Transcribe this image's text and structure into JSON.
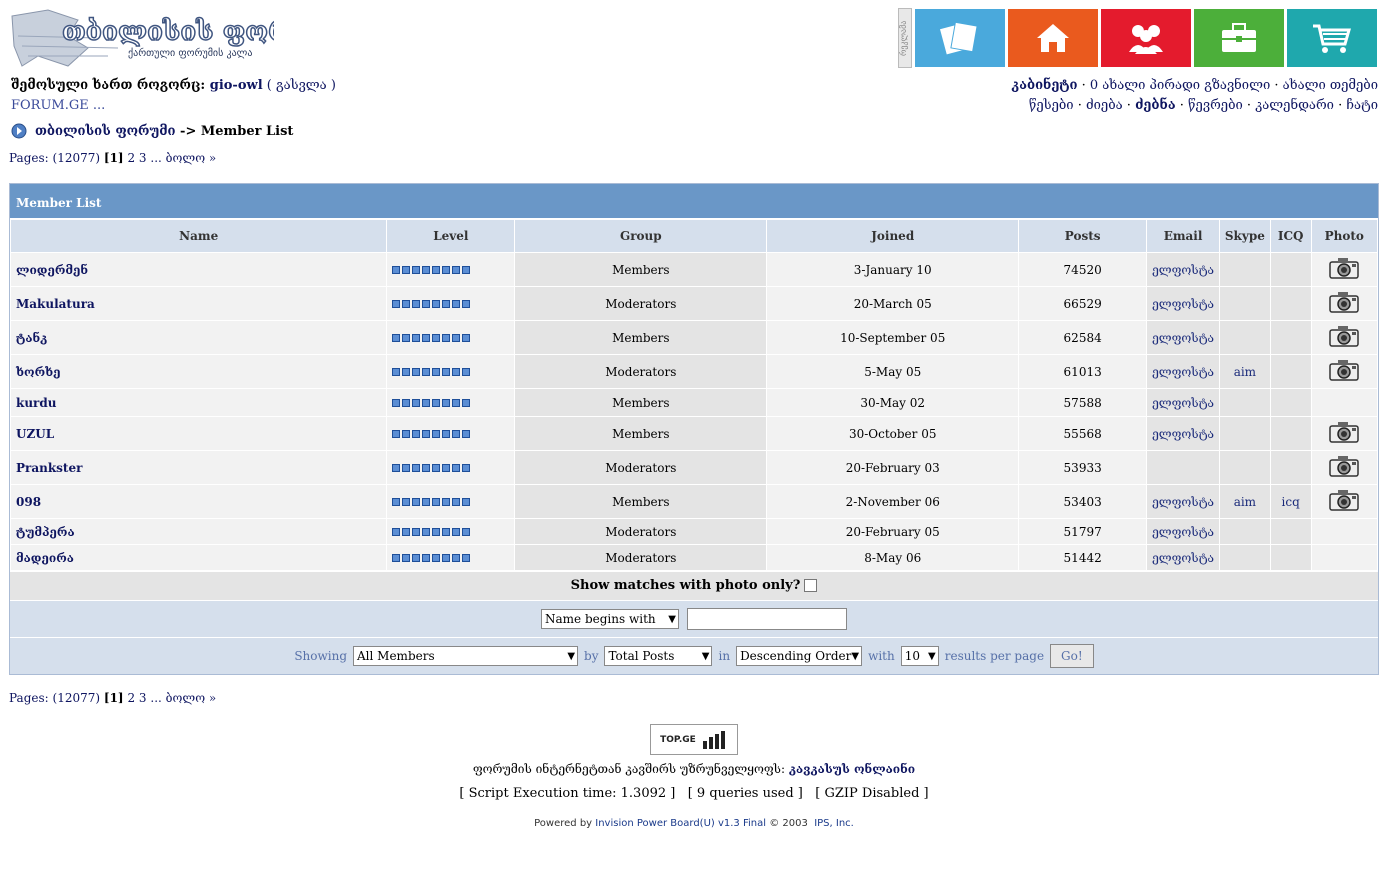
{
  "header": {
    "logo_text": "თბილისის ფორუმი",
    "logo_sub": "ქართული ფორუმის კალა",
    "side_label": "რეკლამა",
    "user_prefix": "შემოსული ხართ როგორც: ",
    "username": "gio-owl",
    "logout": "( გასვლა )",
    "forum_link": "FORUM.GE ...",
    "links1": [
      "კაბინეტი",
      "0 ახალი პირადი გზავნილი",
      "ახალი თემები"
    ],
    "links2": [
      "წესები",
      "ძიება",
      "ძებნა",
      "წევრები",
      "კალენდარი",
      "ჩატი"
    ],
    "tile_colors": [
      "#4aa9dc",
      "#ea5a1e",
      "#e41b2d",
      "#4caf3a",
      "#1fa8ad"
    ],
    "tile_icons": [
      "papers-icon",
      "home-icon",
      "people-icon",
      "briefcase-icon",
      "cart-icon"
    ]
  },
  "nav": {
    "forum": "თბილისის ფორუმი",
    "sep": "->",
    "page": "Member List"
  },
  "pages": {
    "label": "Pages:",
    "count": "(12077)",
    "current": "[1]",
    "p2": "2",
    "p3": "3",
    "dots": "...",
    "last": "ბოლო »"
  },
  "table": {
    "title": "Member List",
    "headers": [
      "Name",
      "Level",
      "Group",
      "Joined",
      "Posts",
      "Email",
      "Skype",
      "ICQ",
      "Photo"
    ],
    "rows": [
      {
        "name": "ლიდერმენ",
        "group": "Members",
        "joined": "3-January 10",
        "posts": "74520",
        "email": "ელფოსტა",
        "skype": "",
        "icq": "",
        "photo": true
      },
      {
        "name": "Makulatura",
        "group": "Moderators",
        "joined": "20-March 05",
        "posts": "66529",
        "email": "ელფოსტა",
        "skype": "",
        "icq": "",
        "photo": true
      },
      {
        "name": "ტანკ",
        "group": "Members",
        "joined": "10-September 05",
        "posts": "62584",
        "email": "ელფოსტა",
        "skype": "",
        "icq": "",
        "photo": true
      },
      {
        "name": "ხორხე",
        "group": "Moderators",
        "joined": "5-May 05",
        "posts": "61013",
        "email": "ელფოსტა",
        "skype": "aim",
        "icq": "",
        "photo": true
      },
      {
        "name": "kurdu",
        "group": "Members",
        "joined": "30-May 02",
        "posts": "57588",
        "email": "ელფოსტა",
        "skype": "",
        "icq": "",
        "photo": false
      },
      {
        "name": "UZUL",
        "group": "Members",
        "joined": "30-October 05",
        "posts": "55568",
        "email": "ელფოსტა",
        "skype": "",
        "icq": "",
        "photo": true
      },
      {
        "name": "Prankster",
        "group": "Moderators",
        "joined": "20-February 03",
        "posts": "53933",
        "email": "",
        "skype": "",
        "icq": "",
        "photo": true
      },
      {
        "name": "098",
        "group": "Members",
        "joined": "2-November 06",
        "posts": "53403",
        "email": "ელფოსტა",
        "skype": "aim",
        "icq": "icq",
        "photo": true
      },
      {
        "name": "ტუმპერა",
        "group": "Moderators",
        "joined": "20-February 05",
        "posts": "51797",
        "email": "ელფოსტა",
        "skype": "",
        "icq": "",
        "photo": false
      },
      {
        "name": "მადეირა",
        "group": "Moderators",
        "joined": "8-May 06",
        "posts": "51442",
        "email": "ელფოსტა",
        "skype": "",
        "icq": "",
        "photo": false
      }
    ]
  },
  "filters": {
    "photo_only": "Show matches with photo only?",
    "name_select": "Name begins with",
    "showing": "Showing",
    "members_select": "All Members",
    "by": "by",
    "sort_select": "Total Posts",
    "in": "in",
    "order_select": "Descending Order",
    "with": "with",
    "per_page_select": "10",
    "results": "results per page",
    "go": "Go!"
  },
  "footer": {
    "badge": "TOP.GE",
    "isp_prefix": "ფორუმის ინტერნეტთან კავშირს უზრუნველყოფს: ",
    "isp": "კავკასუს ონლაინი",
    "stats": "[ Script Execution time: 1.3092 ]   [ 9 queries used ]   [ GZIP Disabled ]",
    "powered_prefix": "Powered by ",
    "powered_link": "Invision Power Board(U) v1.3 Final",
    "copyright": " © 2003  ",
    "ips": "IPS, Inc."
  }
}
